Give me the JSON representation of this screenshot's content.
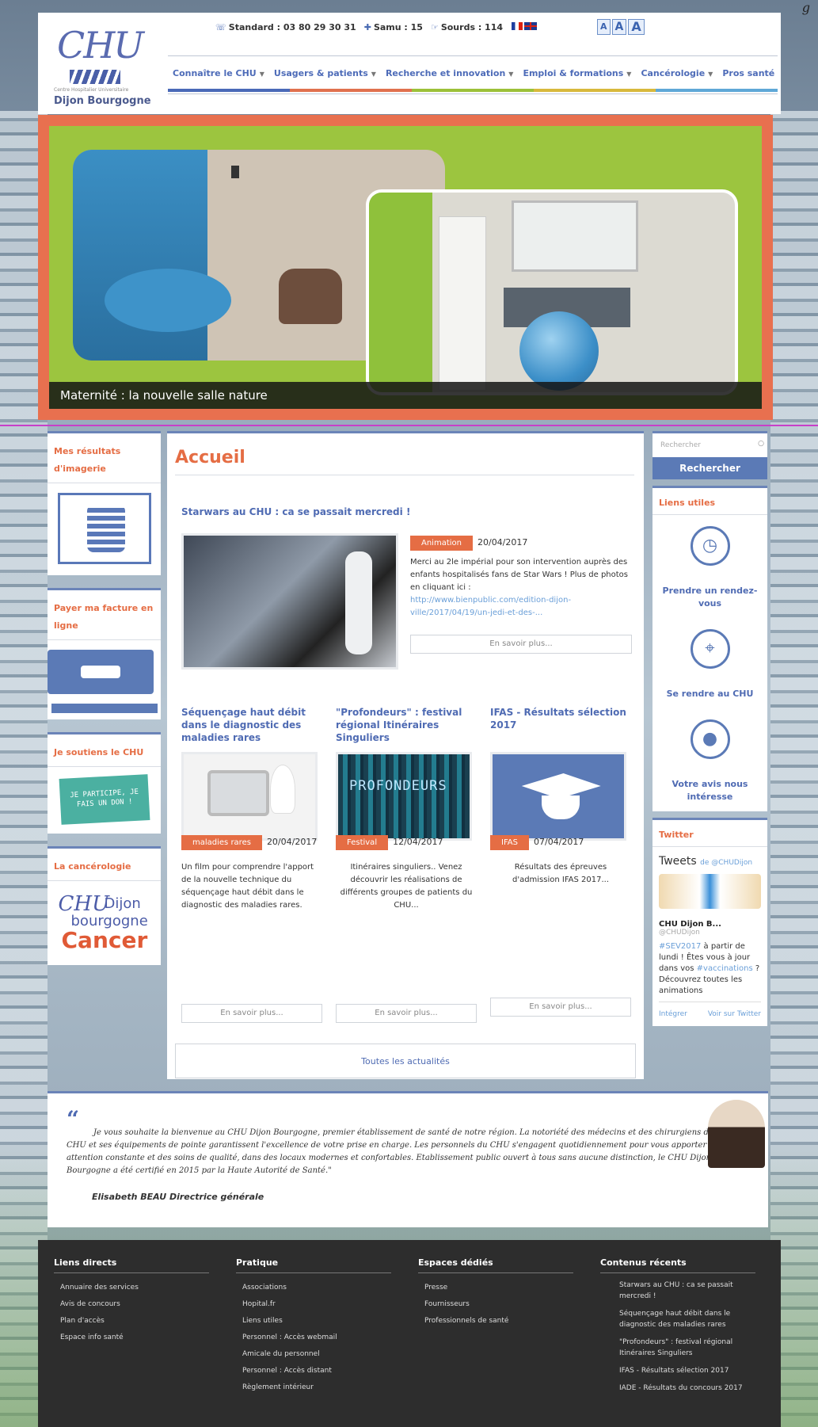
{
  "corner_text": "g",
  "header": {
    "logo_text": "CHU",
    "logo_subtitle": "Centre Hospitalier Universitaire",
    "logo_name": "Dijon Bourgogne",
    "standard": "Standard : 03 80 29 30 31",
    "samu": "Samu : 15",
    "sourds": "Sourds : 114",
    "fontsizes": [
      "A",
      "A",
      "A"
    ],
    "nav": [
      {
        "label": "Connaître le CHU"
      },
      {
        "label": "Usagers & patients"
      },
      {
        "label": "Recherche et innovation"
      },
      {
        "label": "Emploi & formations"
      },
      {
        "label": "Cancérologie"
      },
      {
        "label": "Pros santé"
      }
    ]
  },
  "slider": {
    "caption": "Maternité : la nouvelle salle nature"
  },
  "left": {
    "imaging_title": "Mes résultats d'imagerie",
    "invoice_title": "Payer ma facture en ligne",
    "support_title": "Je soutiens le CHU",
    "support_badge": "JE PARTICIPE, JE FAIS UN DON !",
    "cancer_title": "La cancérologie",
    "cancer_logo": {
      "a": "CHU",
      "b": "Dijon",
      "c": "bourgogne",
      "d": "Cancer"
    }
  },
  "main": {
    "title": "Accueil",
    "featured": {
      "title": "Starwars au CHU : ca se passait mercredi !",
      "tag": "Animation",
      "date": "20/04/2017",
      "text": "Merci au 2le impérial pour son intervention auprès des enfants hospitalisés fans de Star Wars ! Plus de photos en cliquant ici :",
      "link": "http://www.bienpublic.com/edition-dijon-ville/2017/04/19/un-jedi-et-des-...",
      "more": "En savoir plus..."
    },
    "articles": [
      {
        "title": "Séquençage haut débit dans le diagnostic des maladies rares",
        "tag": "maladies rares",
        "date": "20/04/2017",
        "text": "Un film pour comprendre l'apport de la nouvelle technique du séquençage haut débit dans le diagnostic des maladies rares.",
        "more": "En savoir plus..."
      },
      {
        "title": "\"Profondeurs\" : festival régional Itinéraires Singuliers",
        "tag": "Festival",
        "date": "12/04/2017",
        "text": "Itinéraires singuliers.. Venez découvrir les réalisations de différents groupes de patients du CHU...",
        "more": "En savoir plus...",
        "pic_text": "PROFONDEURS"
      },
      {
        "title": "IFAS - Résultats sélection 2017",
        "tag": "IFAS",
        "date": "07/04/2017",
        "text": "Résultats des épreuves d'admission IFAS 2017...",
        "more": "En savoir plus..."
      }
    ],
    "all_news": "Toutes les actualités"
  },
  "right": {
    "search_placeholder": "Rechercher",
    "search_button": "Rechercher",
    "useful_title": "Liens utiles",
    "utils": [
      {
        "label": "Prendre un rendez-vous",
        "icon": "clock-icon"
      },
      {
        "label": "Se rendre au CHU",
        "icon": "map-icon"
      },
      {
        "label": "Votre avis nous intéresse",
        "icon": "speech-bubble-icon"
      }
    ],
    "twitter_title": "Twitter",
    "tweets_head": "Tweets",
    "tweets_by": "de @CHUDijon",
    "tweet_account": "CHU Dijon B...",
    "tweet_handle": "@CHUDijon",
    "tweet_body_hl": "#SEV2017",
    "tweet_body": " à partir de lundi ! Êtes vous à jour dans vos ",
    "tweet_body_hl2": "#vaccinations",
    "tweet_body2": " ? Découvrez toutes les animations",
    "tweet_embed": "Intégrer",
    "tweet_view": "Voir sur Twitter"
  },
  "quote": {
    "mark": "“",
    "text": "Je vous souhaite la bienvenue au CHU Dijon Bourgogne, premier établissement de santé de notre région. La notoriété des médecins et des chirurgiens du CHU et ses équipements de pointe garantissent l'excellence de votre prise en charge. Les personnels du CHU s'engagent quotidiennement pour vous apporter une attention constante et des soins de qualité, dans des locaux modernes et confortables. Etablissement public ouvert à tous sans aucune distinction, le CHU Dijon Bourgogne a été certifié en 2015 par la Haute Autorité de Santé.\"",
    "signature": "Elisabeth BEAU Directrice générale"
  },
  "footer": {
    "cols": [
      {
        "title": "Liens directs",
        "items": [
          "Annuaire des services",
          "Avis de concours",
          "Plan d'accès",
          "Espace info santé"
        ]
      },
      {
        "title": "Pratique",
        "items": [
          "Associations",
          "Hopital.fr",
          "Liens utiles",
          "Personnel : Accès webmail",
          "Amicale du personnel",
          "Personnel : Accès distant",
          "Règlement intérieur"
        ]
      },
      {
        "title": "Espaces dédiés",
        "items": [
          "Presse",
          "Fournisseurs",
          "Professionnels de santé"
        ]
      },
      {
        "title": "Contenus récents",
        "items": [
          "Starwars au CHU : ca se passait mercredi !",
          "Séquençage haut débit dans le diagnostic des maladies rares",
          "\"Profondeurs\" : festival régional Itinéraires Singuliers",
          "IFAS - Résultats sélection 2017",
          "IADE - Résultats du concours 2017"
        ]
      }
    ]
  }
}
